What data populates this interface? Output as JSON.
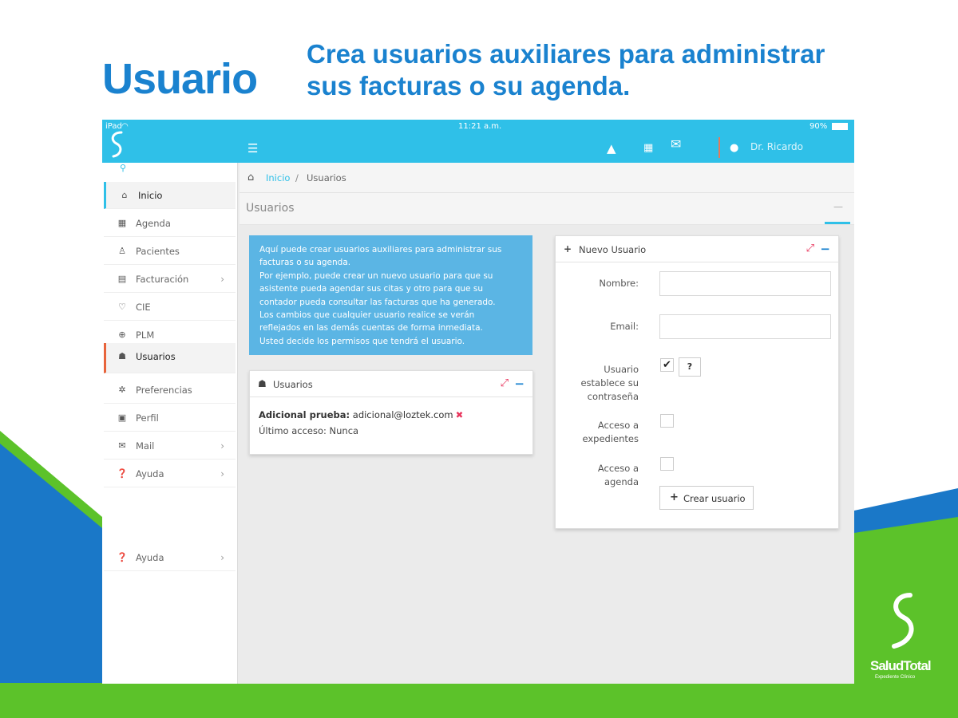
{
  "promo": {
    "title": "Usuario",
    "subtitle": "Crea usuarios auxiliares para administrar sus facturas o su agenda."
  },
  "statusbar": {
    "device": "iPad",
    "time": "11:21 a.m.",
    "battery": "90%"
  },
  "topbar": {
    "user_name": "Dr. Ricardo"
  },
  "sidebar": {
    "items": [
      {
        "label": "Inicio",
        "icon": "home-icon"
      },
      {
        "label": "Agenda",
        "icon": "calendar-icon"
      },
      {
        "label": "Pacientes",
        "icon": "patient-icon"
      },
      {
        "label": "Facturación",
        "icon": "invoice-icon"
      },
      {
        "label": "CIE",
        "icon": "stethoscope-icon"
      },
      {
        "label": "PLM",
        "icon": "plm-icon"
      },
      {
        "label": "Usuarios",
        "icon": "users-icon"
      },
      {
        "label": "Preferencias",
        "icon": "gear-icon"
      },
      {
        "label": "Perfil",
        "icon": "image-icon"
      },
      {
        "label": "Mail",
        "icon": "mail-icon"
      },
      {
        "label": "Ayuda",
        "icon": "help-icon"
      },
      {
        "label": "Ayuda",
        "icon": "help-icon"
      }
    ]
  },
  "breadcrumb": {
    "home": "Inicio",
    "separator": "/",
    "current": "Usuarios"
  },
  "page": {
    "title": "Usuarios"
  },
  "info": {
    "lines": [
      "Aquí puede crear usuarios auxiliares para administrar sus",
      "facturas o su agenda.",
      "Por ejemplo, puede crear un nuevo usuario para que su",
      "asistente pueda agendar sus citas y otro para que su",
      "contador pueda consultar las facturas que ha generado.",
      "Los cambios que cualquier usuario realice se verán",
      "reflejados en las demás cuentas de forma inmediata.",
      "Usted decide los permisos que tendrá el usuario."
    ]
  },
  "users_panel": {
    "title": "Usuarios",
    "user_name": "Adicional prueba:",
    "user_email": "adicional@loztek.com",
    "last_access": "Último acceso: Nunca"
  },
  "new_user_panel": {
    "title": "Nuevo Usuario",
    "name_label": "Nombre:",
    "email_label": "Email:",
    "name_value": "",
    "email_value": "",
    "password_label": "Usuario establece su contraseña",
    "password_checked": true,
    "help_label": "?",
    "records_label": "Acceso a expedientes",
    "agenda_label": "Acceso a agenda",
    "create_label": "Crear usuario"
  },
  "logo": {
    "brand": "SaludTotal",
    "tagline": "Expediente Clínico"
  },
  "colors": {
    "accent": "#2fc0e8",
    "brand_blue": "#1a82cf",
    "brand_green": "#5cc22a",
    "info_box": "#5bb5e4",
    "danger": "#e8325a"
  }
}
